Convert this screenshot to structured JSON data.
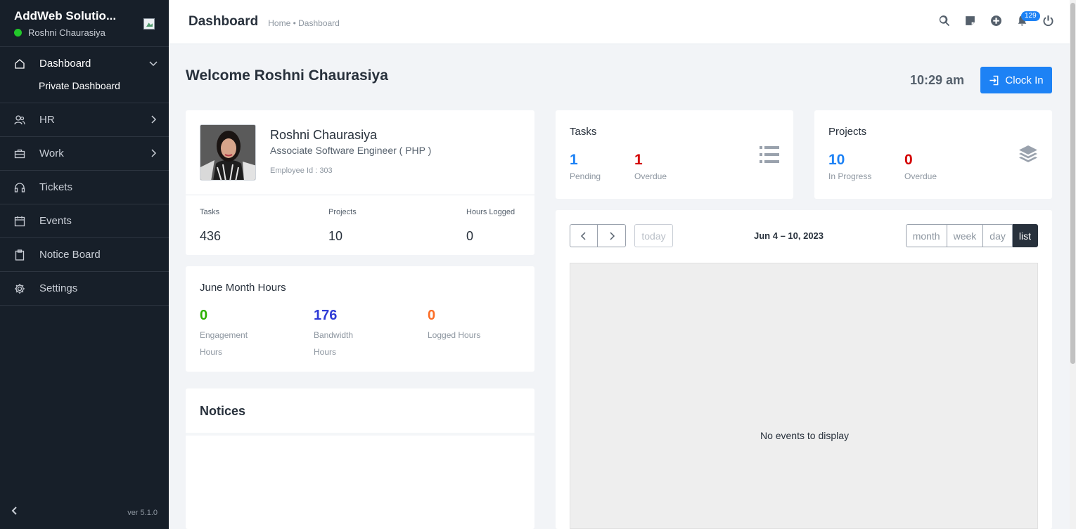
{
  "sidebar": {
    "company": "AddWeb Solutio...",
    "user": "Roshni Chaurasiya",
    "items": [
      {
        "label": "Dashboard",
        "icon": "home-icon"
      },
      {
        "label": "HR",
        "icon": "users-icon"
      },
      {
        "label": "Work",
        "icon": "briefcase-icon"
      },
      {
        "label": "Tickets",
        "icon": "headset-icon"
      },
      {
        "label": "Events",
        "icon": "calendar-icon"
      },
      {
        "label": "Notice Board",
        "icon": "clipboard-icon"
      },
      {
        "label": "Settings",
        "icon": "gear-icon"
      }
    ],
    "subitem": "Private Dashboard",
    "version": "ver 5.1.0"
  },
  "header": {
    "title": "Dashboard",
    "breadcrumb": "Home • Dashboard",
    "notification_count": "129"
  },
  "welcome": "Welcome Roshni Chaurasiya",
  "clock": {
    "time": "10:29 am",
    "button_label": "Clock In"
  },
  "profile": {
    "name": "Roshni Chaurasiya",
    "role": "Associate Software Engineer ( PHP )",
    "employee_id": "Employee Id : 303",
    "stats": [
      {
        "label": "Tasks",
        "value": "436"
      },
      {
        "label": "Projects",
        "value": "10"
      },
      {
        "label": "Hours Logged",
        "value": "0"
      }
    ]
  },
  "month_hours": {
    "title": "June Month Hours",
    "items": [
      {
        "value": "0",
        "label": "Engagement Hours",
        "color": "#2cb100"
      },
      {
        "value": "176",
        "label": "Bandwidth Hours",
        "color": "#2f3bd6"
      },
      {
        "value": "0",
        "label": "Logged Hours",
        "color": "#fc6d26"
      }
    ]
  },
  "notices": {
    "title": "Notices"
  },
  "tasks": {
    "title": "Tasks",
    "items": [
      {
        "value": "1",
        "label": "Pending",
        "color": "#1d82f5"
      },
      {
        "value": "1",
        "label": "Overdue",
        "color": "#d30000"
      }
    ]
  },
  "projects": {
    "title": "Projects",
    "items": [
      {
        "value": "10",
        "label": "In Progress",
        "color": "#1d82f5"
      },
      {
        "value": "0",
        "label": "Overdue",
        "color": "#d30000"
      }
    ]
  },
  "calendar": {
    "today": "today",
    "range": "Jun 4 – 10, 2023",
    "views": [
      "month",
      "week",
      "day",
      "list"
    ],
    "active_view": "list",
    "empty_text": "No events to display"
  }
}
